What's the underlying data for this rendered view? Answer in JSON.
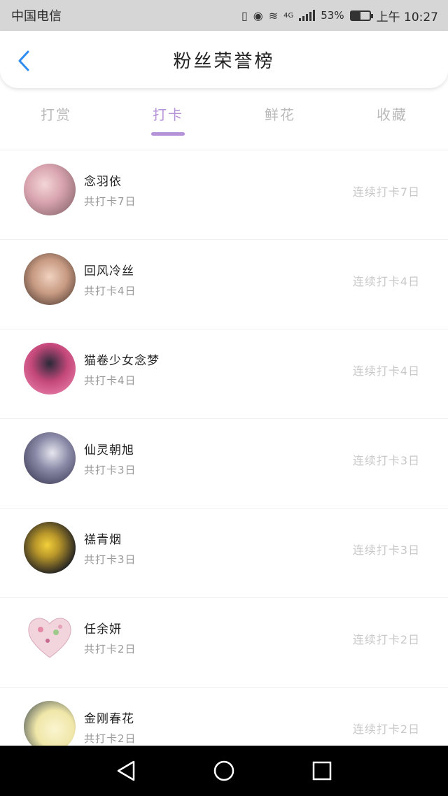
{
  "status_bar": {
    "carrier": "中国电信",
    "battery": "53%",
    "battery_level": 0.53,
    "time": "上午 10:27",
    "network": "4G",
    "icons": [
      "vibrate-icon",
      "eye-icon",
      "wifi-icon",
      "signal-icon",
      "battery-icon"
    ]
  },
  "header": {
    "title": "粉丝荣誉榜",
    "back_icon": "chevron-left-icon"
  },
  "tabs": [
    {
      "label": "打赏",
      "active": false
    },
    {
      "label": "打卡",
      "active": true
    },
    {
      "label": "鲜花",
      "active": false
    },
    {
      "label": "收藏",
      "active": false
    }
  ],
  "colors": {
    "accent": "#b592d8",
    "back_arrow": "#2f8cf0",
    "muted_text": "#c8c8c8"
  },
  "list": [
    {
      "name": "念羽依",
      "total": "共打卡7日",
      "streak": "连续打卡7日"
    },
    {
      "name": "回风冷丝",
      "total": "共打卡4日",
      "streak": "连续打卡4日"
    },
    {
      "name": "猫卷少女念梦",
      "total": "共打卡4日",
      "streak": "连续打卡4日"
    },
    {
      "name": "仙灵朝旭",
      "total": "共打卡3日",
      "streak": "连续打卡3日"
    },
    {
      "name": "禚青烟",
      "total": "共打卡3日",
      "streak": "连续打卡3日"
    },
    {
      "name": "任余妍",
      "total": "共打卡2日",
      "streak": "连续打卡2日"
    },
    {
      "name": "金刚春花",
      "total": "共打卡2日",
      "streak": "连续打卡2日"
    }
  ],
  "nav_bar": {
    "icons": [
      "back-triangle-icon",
      "home-circle-icon",
      "recents-square-icon"
    ]
  }
}
